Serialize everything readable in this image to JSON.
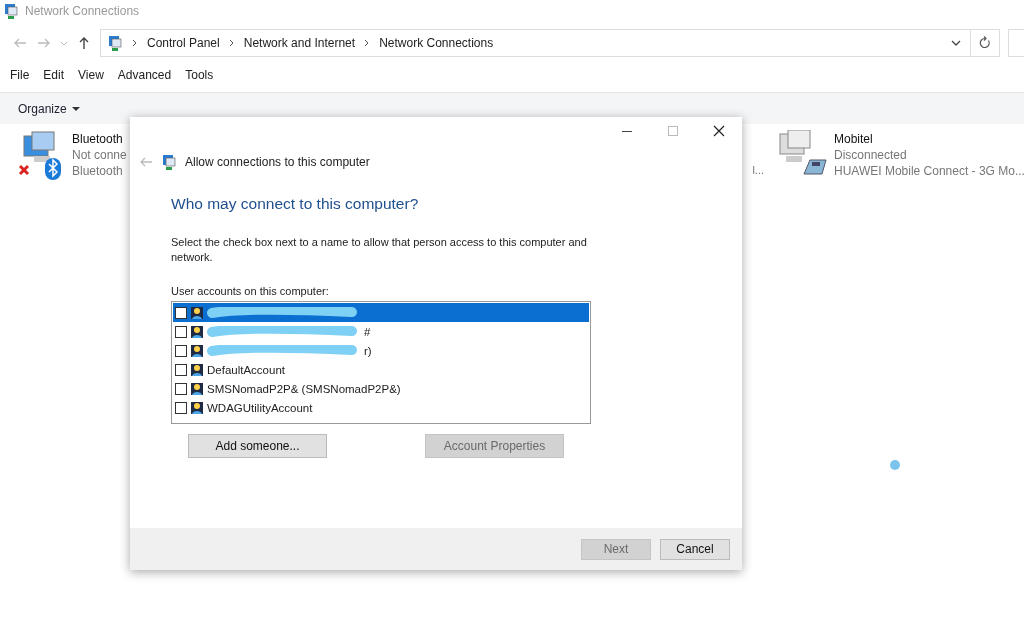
{
  "window": {
    "title": "Network Connections"
  },
  "address_bar": {
    "path": [
      "Control Panel",
      "Network and Internet",
      "Network Connections"
    ]
  },
  "menu": [
    "File",
    "Edit",
    "View",
    "Advanced",
    "Tools"
  ],
  "toolbar": {
    "organize": "Organize"
  },
  "connections": [
    {
      "kind": "bluetooth",
      "name": "Bluetooth",
      "status": "Not conne",
      "device": "Bluetooth"
    },
    {
      "kind": "fragment",
      "device": "l..."
    },
    {
      "kind": "modem",
      "name": "Mobitel",
      "status": "Disconnected",
      "device": "HUAWEI Mobile Connect - 3G Mo..."
    }
  ],
  "dialog": {
    "title": "Allow connections to this computer",
    "heading": "Who may connect to this computer?",
    "instructions": "Select the check box next to a name to allow that person access to this computer and network.",
    "list_label": "User accounts on this computer:",
    "accounts": [
      {
        "redacted": true,
        "checked": false,
        "selected": true
      },
      {
        "redacted": true,
        "visible_text": "#",
        "checked": false,
        "selected": false
      },
      {
        "redacted": true,
        "visible_text": "r)",
        "checked": false,
        "selected": false
      },
      {
        "redacted": false,
        "name": "DefaultAccount",
        "checked": false,
        "selected": false
      },
      {
        "redacted": false,
        "name": "SMSNomadP2P& (SMSNomadP2P&)",
        "checked": false,
        "selected": false
      },
      {
        "redacted": false,
        "name": "WDAGUtilityAccount",
        "checked": false,
        "selected": false
      }
    ],
    "buttons": [
      {
        "label": "Add someone...",
        "disabled": false
      },
      {
        "label": "Account Properties",
        "disabled": true
      }
    ],
    "footer_buttons": [
      {
        "label": "Next",
        "disabled": true
      },
      {
        "label": "Cancel",
        "disabled": false
      }
    ]
  },
  "busy_indicator": true
}
